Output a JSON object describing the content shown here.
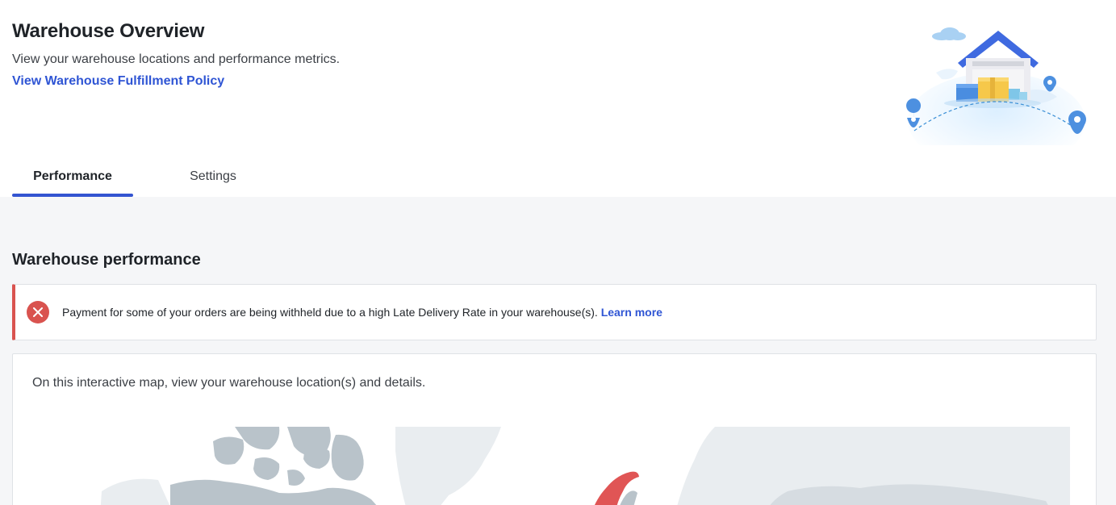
{
  "header": {
    "title": "Warehouse Overview",
    "subtitle": "View your warehouse locations and performance metrics.",
    "policy_link": "View Warehouse Fulfillment Policy",
    "illustration_icon": "warehouse-globe-illustration"
  },
  "tabs": [
    {
      "label": "Performance",
      "active": true
    },
    {
      "label": "Settings",
      "active": false
    }
  ],
  "performance": {
    "section_title": "Warehouse performance",
    "alert": {
      "icon": "error-x-icon",
      "message": "Payment for some of your orders are being withheld due to a high Late Delivery Rate in your warehouse(s).",
      "link": "Learn more"
    },
    "map": {
      "description": "On this interactive map, view your warehouse location(s) and details.",
      "highlight_color": "#e05555"
    }
  },
  "colors": {
    "accent": "#3354d1",
    "link": "#2f55d4",
    "error": "#d9534f",
    "map_land": "#b9c3ca",
    "map_land_light": "#e9edf0"
  }
}
